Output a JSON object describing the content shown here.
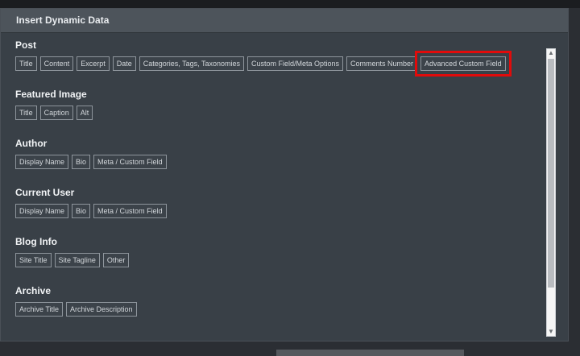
{
  "dialog": {
    "title": "Insert Dynamic Data"
  },
  "sections": [
    {
      "title": "Post",
      "items": [
        "Title",
        "Content",
        "Excerpt",
        "Date",
        "Categories, Tags, Taxonomies",
        "Custom Field/Meta Options",
        "Comments Number",
        "Advanced Custom Field"
      ]
    },
    {
      "title": "Featured Image",
      "items": [
        "Title",
        "Caption",
        "Alt"
      ]
    },
    {
      "title": "Author",
      "items": [
        "Display Name",
        "Bio",
        "Meta / Custom Field"
      ]
    },
    {
      "title": "Current User",
      "items": [
        "Display Name",
        "Bio",
        "Meta / Custom Field"
      ]
    },
    {
      "title": "Blog Info",
      "items": [
        "Site Title",
        "Site Tagline",
        "Other"
      ]
    },
    {
      "title": "Archive",
      "items": [
        "Archive Title",
        "Archive Description"
      ]
    }
  ],
  "scrollbar": {
    "up_icon": "▲",
    "down_icon": "▼"
  }
}
